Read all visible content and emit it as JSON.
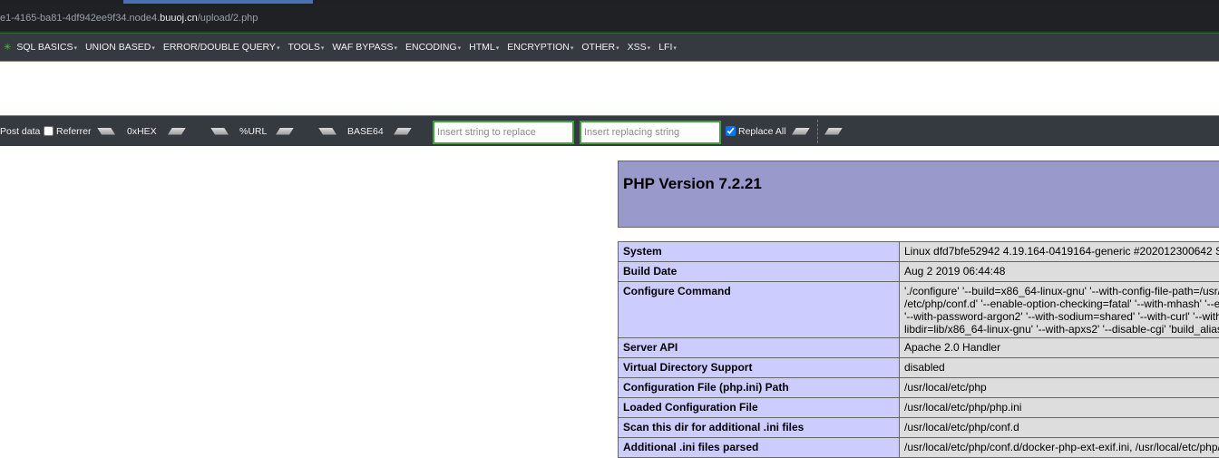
{
  "browser": {
    "url_prefix": "e1-4165-ba81-4df942ee9f34.node4.",
    "url_host": "buuoj.cn",
    "url_path": "/upload/2.php"
  },
  "hackbar": {
    "menu": [
      "SQL BASICS",
      "UNION BASED",
      "ERROR/DOUBLE QUERY",
      "TOOLS",
      "WAF BYPASS",
      "ENCODING",
      "HTML",
      "ENCRYPTION",
      "OTHER",
      "XSS",
      "LFI"
    ],
    "post_data_label": "Post data",
    "referrer_label": "Referrer",
    "hex_label": "0xHEX",
    "url_label": "%URL",
    "base64_label": "BASE64",
    "replace_placeholder": "Insert string to replace",
    "replacing_placeholder": "Insert replacing string",
    "replace_all_label": "Replace All",
    "post_data_checked": false,
    "referrer_checked": false,
    "replace_all_checked": true
  },
  "phpinfo": {
    "title": "PHP Version 7.2.21",
    "rows": [
      {
        "key": "System",
        "value": "Linux dfd7bfe52942 4.19.164-0419164-generic #202012300642 S",
        "lines": 1
      },
      {
        "key": "Build Date",
        "value": "Aug 2 2019 06:44:48",
        "lines": 1
      },
      {
        "key": "Configure Command",
        "value": "'./configure' '--build=x86_64-linux-gnu' '--with-config-file-path=/usr/\n/etc/php/conf.d' '--enable-option-checking=fatal' '--with-mhash' '--e\n'--with-password-argon2' '--with-sodium=shared' '--with-curl' '--with\nlibdir=lib/x86_64-linux-gnu' '--with-apxs2' '--disable-cgi' 'build_alias",
        "lines": 4
      },
      {
        "key": "Server API",
        "value": "Apache 2.0 Handler",
        "lines": 1
      },
      {
        "key": "Virtual Directory Support",
        "value": "disabled",
        "lines": 1
      },
      {
        "key": "Configuration File (php.ini) Path",
        "value": "/usr/local/etc/php",
        "lines": 1
      },
      {
        "key": "Loaded Configuration File",
        "value": "/usr/local/etc/php/php.ini",
        "lines": 1
      },
      {
        "key": "Scan this dir for additional .ini files",
        "value": "/usr/local/etc/php/conf.d",
        "lines": 1
      },
      {
        "key": "Additional .ini files parsed",
        "value": "/usr/local/etc/php/conf.d/docker-php-ext-exif.ini, /usr/local/etc/php/",
        "lines": 1
      }
    ]
  },
  "colors": {
    "hackbar_bg": "#353a40",
    "accent_green": "#3fa13f",
    "php_header": "#9999cc",
    "php_key_bg": "#ccccff",
    "php_value_bg": "#dddddd"
  }
}
